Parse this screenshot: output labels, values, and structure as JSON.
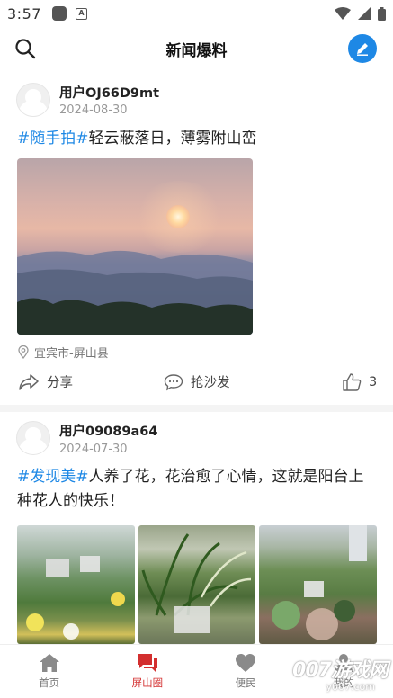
{
  "status_bar": {
    "time": "3:57"
  },
  "header": {
    "title": "新闻爆料"
  },
  "posts": [
    {
      "username": "用户OJ66D9mt",
      "date": "2024-08-30",
      "tag": "#随手拍#",
      "text": "轻云蔽落日，薄雾附山峦",
      "location": "宜宾市-屏山县",
      "share_label": "分享",
      "comment_label": "抢沙发",
      "likes": "3"
    },
    {
      "username": "用户09089a64",
      "date": "2024-07-30",
      "tag": "#发现美#",
      "text": "人养了花，花治愈了心情，这就是阳台上种花人的快乐！"
    }
  ],
  "bottom_nav": {
    "items": [
      {
        "label": "首页"
      },
      {
        "label": "屏山圈"
      },
      {
        "label": "便民"
      },
      {
        "label": "我的"
      }
    ]
  },
  "watermark": {
    "text": "007游戏网",
    "sub": "y007.com"
  },
  "colors": {
    "accent": "#1e88e5",
    "active_nav": "#d32f2f"
  }
}
